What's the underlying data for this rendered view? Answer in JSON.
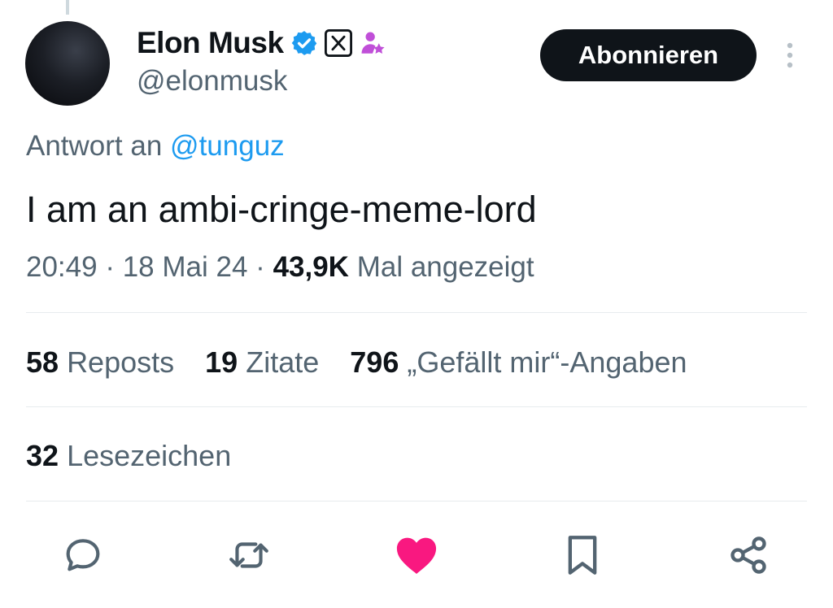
{
  "author": {
    "display_name": "Elon Musk",
    "handle": "@elonmusk",
    "badges": [
      "verified-check-icon",
      "x-affiliate-icon",
      "person-star-icon"
    ]
  },
  "follow_button": {
    "label": "Abonnieren"
  },
  "reply_context": {
    "prefix": "Antwort an",
    "mention": "@tunguz"
  },
  "tweet": {
    "text": "I am an ambi-cringe-meme-lord"
  },
  "meta": {
    "time": "20:49",
    "separator": "·",
    "date": "18 Mai 24",
    "views_count": "43,9K",
    "views_label": "Mal angezeigt"
  },
  "stats": {
    "reposts_count": "58",
    "reposts_label": "Reposts",
    "quotes_count": "19",
    "quotes_label": "Zitate",
    "likes_count": "796",
    "likes_label": "„Gefällt mir“-Angaben",
    "bookmarks_count": "32",
    "bookmarks_label": "Lesezeichen"
  },
  "actions": [
    "reply-icon",
    "repost-icon",
    "like-icon",
    "bookmark-icon",
    "share-icon"
  ],
  "colors": {
    "text_primary": "#0f1419",
    "text_secondary": "#536471",
    "link": "#1d9bf0",
    "verified": "#1d9bf0",
    "like_active": "#f91880",
    "affiliate_purple": "#c04fd8",
    "divider": "#e7ebee"
  }
}
